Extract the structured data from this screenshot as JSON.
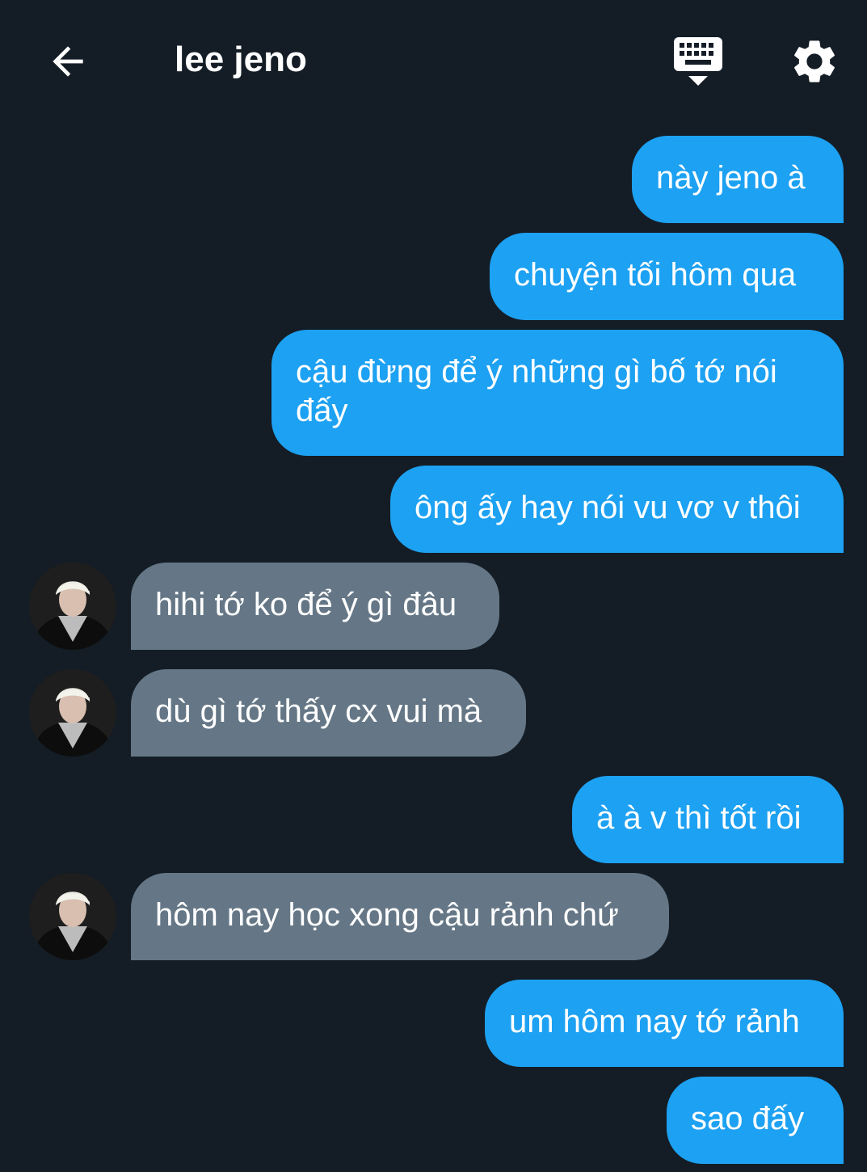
{
  "header": {
    "title": "lee jeno",
    "back_icon": "arrow-left-icon",
    "keyboard_icon": "keyboard-icon",
    "settings_icon": "gear-icon"
  },
  "colors": {
    "background": "#141d26",
    "sent_bubble": "#1da1f2",
    "received_bubble": "#657786",
    "text": "#ffffff"
  },
  "messages": [
    {
      "side": "sent",
      "text": "này jeno à"
    },
    {
      "side": "sent",
      "text": "chuyện tối hôm qua"
    },
    {
      "side": "sent",
      "text": "cậu đừng để ý những gì bố tớ nói đấy"
    },
    {
      "side": "sent",
      "text": "ông ấy hay nói vu vơ v thôi"
    },
    {
      "side": "received",
      "text": "hihi tớ ko để ý gì đâu"
    },
    {
      "side": "received",
      "text": "dù gì tớ thấy cx vui mà"
    },
    {
      "side": "sent",
      "text": "à à v thì tốt rồi"
    },
    {
      "side": "received",
      "text": "hôm nay học xong cậu rảnh chứ"
    },
    {
      "side": "sent",
      "text": "um hôm nay tớ rảnh"
    },
    {
      "side": "sent",
      "text": "sao đấy"
    }
  ]
}
